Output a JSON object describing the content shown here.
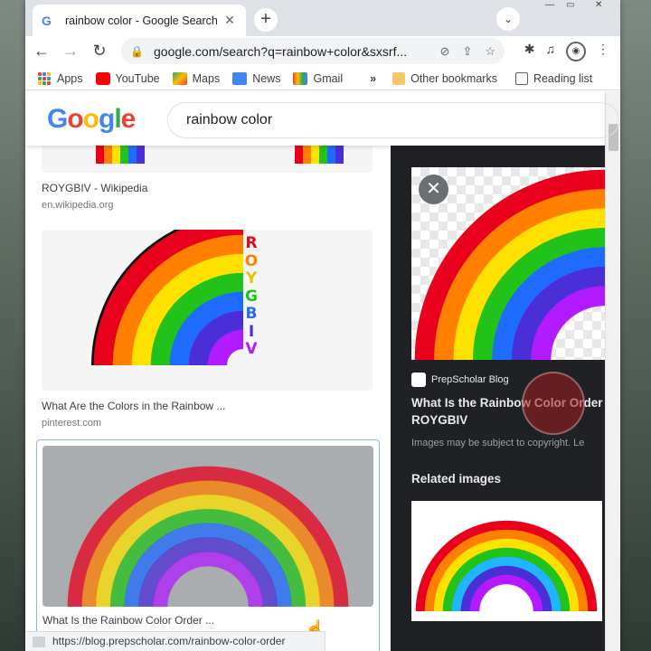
{
  "tab": {
    "title": "rainbow color - Google Search",
    "close": "✕"
  },
  "toolbar": {
    "url": "google.com/search?q=rainbow+color&sxsrf..."
  },
  "bookmarks": {
    "items": [
      "Apps",
      "YouTube",
      "Maps",
      "News",
      "Gmail"
    ],
    "more": "»",
    "other": "Other bookmarks",
    "reading": "Reading list"
  },
  "search": {
    "query": "rainbow color"
  },
  "results": [
    {
      "caption": "ROYGBIV - Wikipedia",
      "source": "en.wikipedia.org"
    },
    {
      "caption": "What Are the Colors in the Rainbow ...",
      "source": "pinterest.com",
      "letters": [
        "R",
        "O",
        "Y",
        "G",
        "B",
        "I",
        "V"
      ]
    },
    {
      "caption": "What Is the Rainbow Color Order ...",
      "source": ""
    }
  ],
  "panel": {
    "source": "PrepScholar Blog",
    "title": "What Is the Rainbow Color Order ROYGBIV",
    "copyright": "Images may be subject to copyright. Le",
    "related": "Related images"
  },
  "status": {
    "url": "https://blog.prepscholar.com/rainbow-color-order"
  },
  "colors": {
    "rainbow": [
      "#e8001c",
      "#ff7f00",
      "#ffe100",
      "#21c21a",
      "#1f6bff",
      "#4b2fd6",
      "#b21bff"
    ],
    "accent": "#1a73e8"
  }
}
